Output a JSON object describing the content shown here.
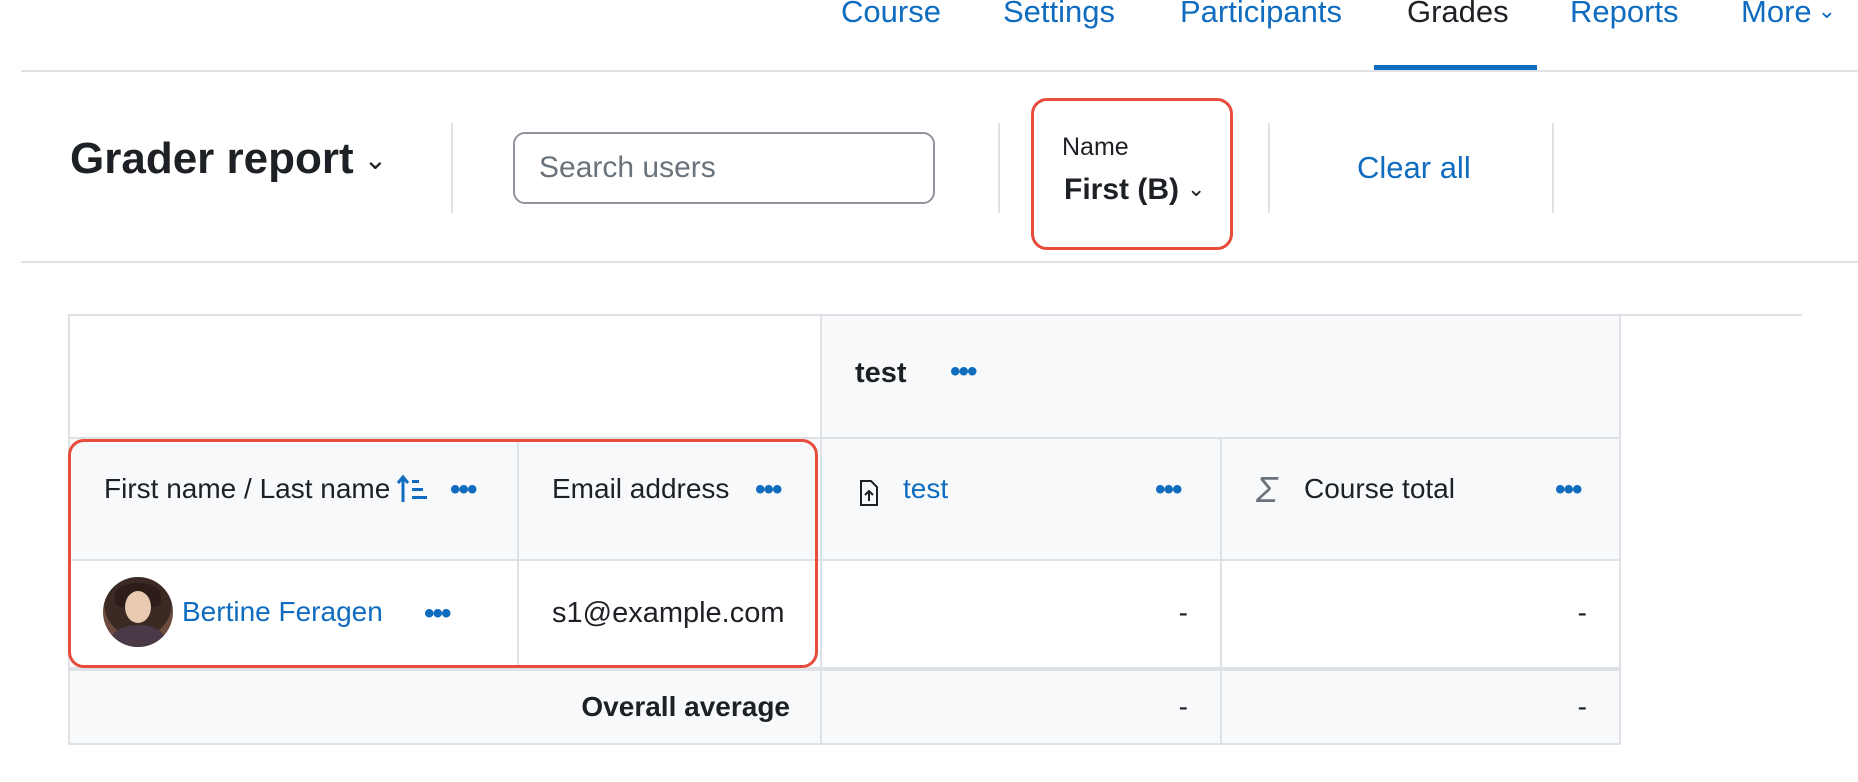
{
  "nav": {
    "tabs": [
      {
        "label": "Course"
      },
      {
        "label": "Settings"
      },
      {
        "label": "Participants"
      },
      {
        "label": "Grades"
      },
      {
        "label": "Reports"
      },
      {
        "label": "More"
      }
    ],
    "active_tab": "Grades"
  },
  "toolbar": {
    "title": "Grader report",
    "search_placeholder": "Search users",
    "search_value": "",
    "name_filter_label": "Name",
    "name_filter_value": "First (B)",
    "clear_all": "Clear all"
  },
  "table": {
    "category_header": "test",
    "columns": {
      "name": "First name / Last name",
      "email": "Email address",
      "item": "test",
      "total": "Course total"
    },
    "rows": [
      {
        "name": "Bertine Feragen",
        "email": "s1@example.com",
        "item_grade": "-",
        "total_grade": "-"
      }
    ],
    "average": {
      "label": "Overall average",
      "item": "-",
      "total": "-"
    }
  },
  "colors": {
    "link": "#0f6cbf",
    "highlight": "#e74c3c",
    "border": "#dee2e6"
  }
}
